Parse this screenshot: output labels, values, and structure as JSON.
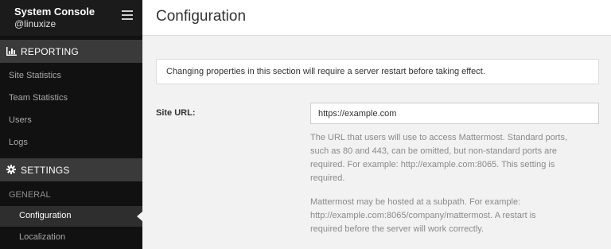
{
  "sidebar": {
    "title": "System Console",
    "user": "@linuxize",
    "sections": [
      {
        "label": "REPORTING"
      },
      {
        "label": "SETTINGS"
      }
    ],
    "reporting_items": [
      {
        "label": "Site Statistics"
      },
      {
        "label": "Team Statistics"
      },
      {
        "label": "Users"
      },
      {
        "label": "Logs"
      }
    ],
    "settings_group": "GENERAL",
    "settings_items": [
      {
        "label": "Configuration"
      },
      {
        "label": "Localization"
      }
    ]
  },
  "main": {
    "title": "Configuration",
    "notice": "Changing properties in this section will require a server restart before taking effect.",
    "site_url": {
      "label": "Site URL:",
      "value": "https://example.com",
      "help_lines_1": [
        "The URL that users will use to access Mattermost. Standard ports,",
        "such as 80 and 443, can be omitted, but non-standard ports are",
        "required. For example: http://example.com:8065. This setting is",
        "required."
      ],
      "help_lines_2": [
        "Mattermost may be hosted at a subpath. For example:",
        "http://example.com:8065/company/mattermost. A restart is",
        "required before the server will work correctly."
      ]
    }
  }
}
